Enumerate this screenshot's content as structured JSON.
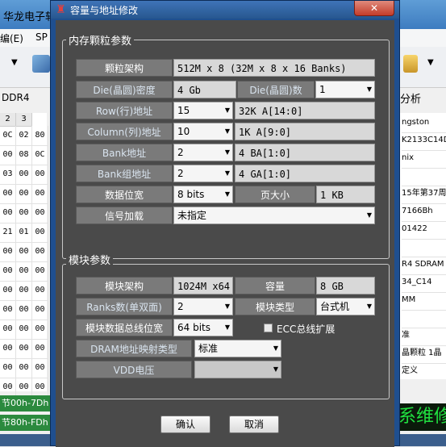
{
  "background_app": {
    "title": "华龙电子软",
    "menu": [
      "编(E)",
      "SP"
    ],
    "ddr_label": "DDR4",
    "analysis_label": "分析",
    "grid_headers": [
      "2",
      "3"
    ],
    "grid_rows": [
      [
        "0C",
        "02",
        "80"
      ],
      [
        "00",
        "08",
        "0C"
      ],
      [
        "03",
        "00",
        "00"
      ],
      [
        "00",
        "00",
        "00"
      ],
      [
        "00",
        "00",
        "00"
      ],
      [
        "21",
        "01",
        "00"
      ],
      [
        "00",
        "00",
        "00"
      ],
      [
        "00",
        "00",
        "00"
      ],
      [
        "00",
        "00",
        "00"
      ],
      [
        "00",
        "00",
        "00"
      ],
      [
        "00",
        "00",
        "00"
      ],
      [
        "00",
        "00",
        "00"
      ],
      [
        "00",
        "00",
        "00"
      ],
      [
        "00",
        "00",
        "00"
      ]
    ],
    "right_values": [
      "ngston",
      "K2133C14D",
      "nix",
      "",
      "15年第37周",
      "7166Bh",
      "01422",
      "",
      "R4 SDRAM",
      "34_C14",
      "MM",
      "",
      "准",
      "晶颗粒 1晶",
      "定义"
    ],
    "status": [
      "节00h-7Dh",
      "节80h-FDh"
    ],
    "brand": "系维修"
  },
  "dialog": {
    "title": "容量与地址修改",
    "close_label": "✕",
    "chip_group": {
      "label": "内存颗粒参数",
      "arch_label": "颗粒架构",
      "arch_value": "512M x 8 (32M x 8 x 16 Banks)",
      "density_label": "Die(晶圆)密度",
      "density_value": "4 Gb",
      "die_count_label": "Die(晶圆)数",
      "die_count_value": "1",
      "row_label": "Row(行)地址",
      "row_value": "15",
      "row_desc": "32K A[14:0]",
      "col_label": "Column(列)地址",
      "col_value": "10",
      "col_desc": "1K A[9:0]",
      "bank_label": "Bank地址",
      "bank_value": "2",
      "bank_desc": "4 BA[1:0]",
      "bankgroup_label": "Bank组地址",
      "bankgroup_value": "2",
      "bankgroup_desc": "4 GA[1:0]",
      "width_label": "数据位宽",
      "width_value": "8 bits",
      "page_label": "页大小",
      "page_value": "1 KB",
      "signal_label": "信号加载",
      "signal_value": "未指定"
    },
    "module_group": {
      "label": "模块参数",
      "arch_label": "模块架构",
      "arch_value": "1024M x64",
      "capacity_label": "容量",
      "capacity_value": "8 GB",
      "ranks_label": "Ranks数(单双面)",
      "ranks_value": "2",
      "type_label": "模块类型",
      "type_value": "台式机",
      "bus_label": "模块数据总线位宽",
      "bus_value": "64 bits",
      "ecc_label": "ECC总线扩展",
      "dram_map_label": "DRAM地址映射类型",
      "dram_map_value": "标准",
      "vdd_label": "VDD电压",
      "vdd_value": ""
    },
    "ok_label": "确认",
    "cancel_label": "取消"
  }
}
